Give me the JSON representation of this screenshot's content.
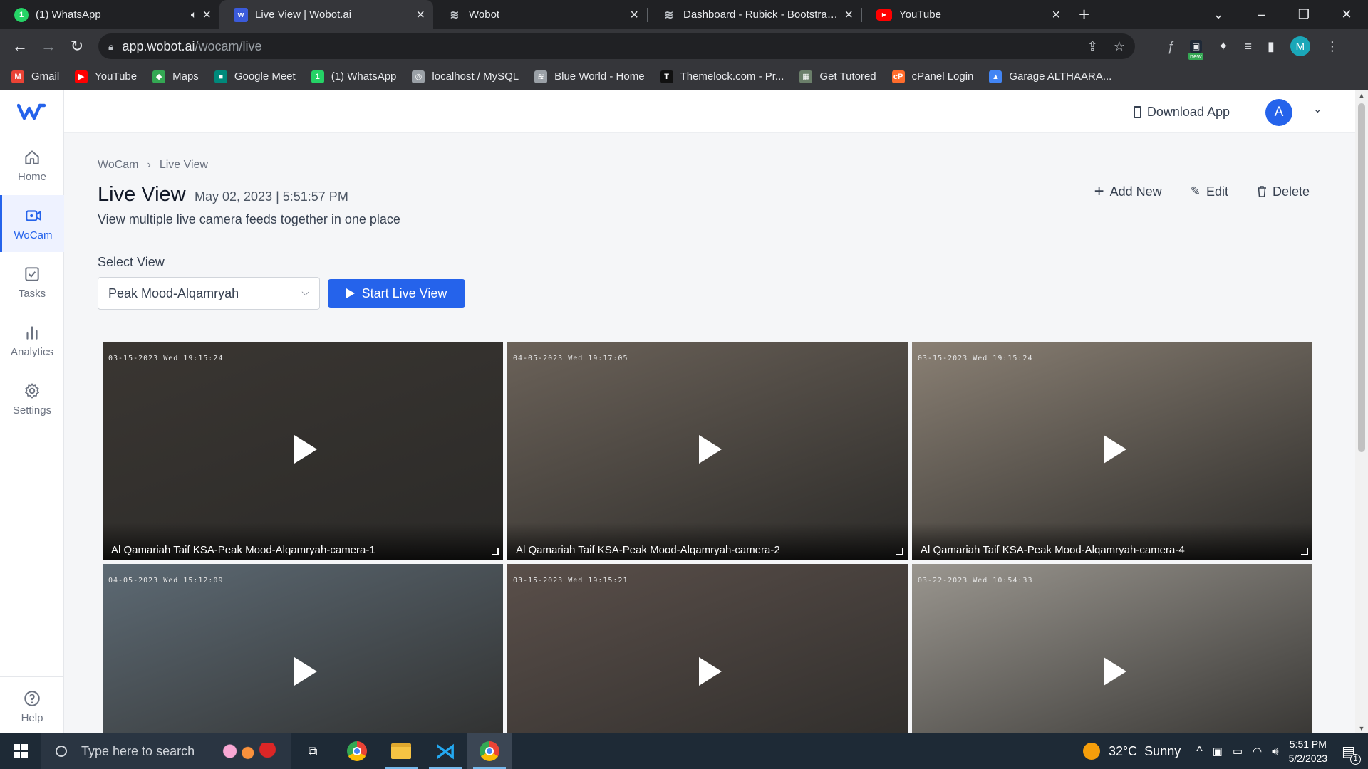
{
  "browser": {
    "tabs": [
      {
        "title": "(1) WhatsApp",
        "icon": "whatsapp-icon",
        "color": "#25d366",
        "muted": true
      },
      {
        "title": "Live View | Wobot.ai",
        "icon": "wobot-icon",
        "color": "#3b5bdb",
        "active": true
      },
      {
        "title": "Wobot",
        "icon": "layers-icon",
        "color": "#9aa0a6"
      },
      {
        "title": "Dashboard - Rubick - Bootstrap H",
        "icon": "layers-icon",
        "color": "#9aa0a6"
      },
      {
        "title": "YouTube",
        "icon": "youtube-icon",
        "color": "#ff0000"
      }
    ],
    "url_host": "app.wobot.ai",
    "url_path": "/wocam/live",
    "profile_initial": "M",
    "ext_badge": "new",
    "bookmarks": [
      {
        "label": "Gmail",
        "color": "#ea4335",
        "glyph": "M"
      },
      {
        "label": "YouTube",
        "color": "#ff0000",
        "glyph": "▶"
      },
      {
        "label": "Maps",
        "color": "#34a853",
        "glyph": "◆"
      },
      {
        "label": "Google Meet",
        "color": "#00897b",
        "glyph": "■"
      },
      {
        "label": "(1) WhatsApp",
        "color": "#25d366",
        "glyph": "1"
      },
      {
        "label": "localhost / MySQL",
        "color": "#9aa0a6",
        "glyph": "◎"
      },
      {
        "label": "Blue World - Home",
        "color": "#9aa0a6",
        "glyph": "≋"
      },
      {
        "label": "Themelock.com - Pr...",
        "color": "#111111",
        "glyph": "T"
      },
      {
        "label": "Get Tutored",
        "color": "#6b7f6a",
        "glyph": "▦"
      },
      {
        "label": "cPanel Login",
        "color": "#ff6c2c",
        "glyph": "cP"
      },
      {
        "label": "Garage ALTHAARA...",
        "color": "#4285f4",
        "glyph": "▲"
      }
    ]
  },
  "sidebar": {
    "logo": "w",
    "items": [
      {
        "label": "Home",
        "icon": "home-icon"
      },
      {
        "label": "WoCam",
        "icon": "camera-icon",
        "active": true
      },
      {
        "label": "Tasks",
        "icon": "tasks-icon"
      },
      {
        "label": "Analytics",
        "icon": "analytics-icon"
      },
      {
        "label": "Settings",
        "icon": "gear-icon"
      }
    ],
    "help": "Help"
  },
  "header": {
    "download": "Download App",
    "avatar": "A"
  },
  "breadcrumb": [
    "WoCam",
    "›",
    "Live View"
  ],
  "page": {
    "title": "Live View",
    "date": "May 02, 2023 | 5:51:57 PM",
    "subtitle": "View multiple live camera feeds together in one place",
    "actions": {
      "add": "Add New",
      "edit": "Edit",
      "delete": "Delete"
    },
    "select_label": "Select View",
    "select_value": "Peak Mood-Alqamryah",
    "start_button": "Start Live View"
  },
  "cameras": [
    {
      "name": "Al Qamariah Taif KSA-Peak Mood-Alqamryah-camera-1",
      "timestamp": "03-15-2023 Wed 19:15:24",
      "tone": "#3a3632"
    },
    {
      "name": "Al Qamariah Taif KSA-Peak Mood-Alqamryah-camera-2",
      "timestamp": "04-05-2023 Wed 19:17:05",
      "tone": "#6b6259"
    },
    {
      "name": "Al Qamariah Taif KSA-Peak Mood-Alqamryah-camera-4",
      "timestamp": "03-15-2023 Wed 19:15:24",
      "tone": "#8a8074"
    },
    {
      "name": "",
      "timestamp": "04-05-2023 Wed 15:12:09",
      "tone": "#5d6a74"
    },
    {
      "name": "",
      "timestamp": "03-15-2023 Wed 19:15:21",
      "tone": "#5a4f4a"
    },
    {
      "name": "",
      "timestamp": "03-22-2023 Wed 10:54:33",
      "tone": "#9a968f"
    }
  ],
  "taskbar": {
    "search_placeholder": "Type here to search",
    "weather": "32°C  Sunny",
    "time": "5:51 PM",
    "date": "5/2/2023",
    "notifications": "1"
  }
}
